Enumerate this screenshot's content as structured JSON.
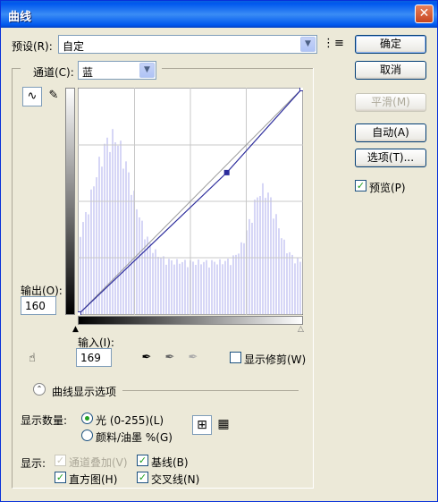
{
  "window": {
    "title": "曲线",
    "close": "✕"
  },
  "preset": {
    "label": "预设(R):",
    "value": "自定"
  },
  "channel": {
    "label": "通道(C):",
    "value": "蓝"
  },
  "buttons": {
    "ok": "确定",
    "cancel": "取消",
    "smooth": "平滑(M)",
    "auto": "自动(A)",
    "options": "选项(T)..."
  },
  "preview": {
    "label": "预览(P)",
    "checked": true
  },
  "output": {
    "label": "输出(O):",
    "value": "160"
  },
  "input": {
    "label": "输入(I):",
    "value": "169"
  },
  "show_clipping": {
    "label": "显示修剪(W)",
    "checked": false
  },
  "curve_display_options": "曲线显示选项",
  "show_amount": {
    "label": "显示数量:",
    "light": "光 (0-255)(L)",
    "pigment": "颜料/油墨 %(G)",
    "selected": "light"
  },
  "show": {
    "label": "显示:",
    "channel_overlays": "通道叠加(V)",
    "baseline": "基线(B)",
    "histogram": "直方图(H)",
    "intersection": "交叉线(N)"
  },
  "colors": {
    "curve": "#2c2c9c",
    "histogram": "#d6d6f6",
    "grid": "#c8c8c8"
  },
  "chart_data": {
    "type": "line",
    "curve_points": [
      [
        0,
        0
      ],
      [
        169,
        160
      ],
      [
        255,
        255
      ]
    ],
    "xlim": [
      0,
      255
    ],
    "ylim": [
      0,
      255
    ],
    "grid": "4x4"
  }
}
